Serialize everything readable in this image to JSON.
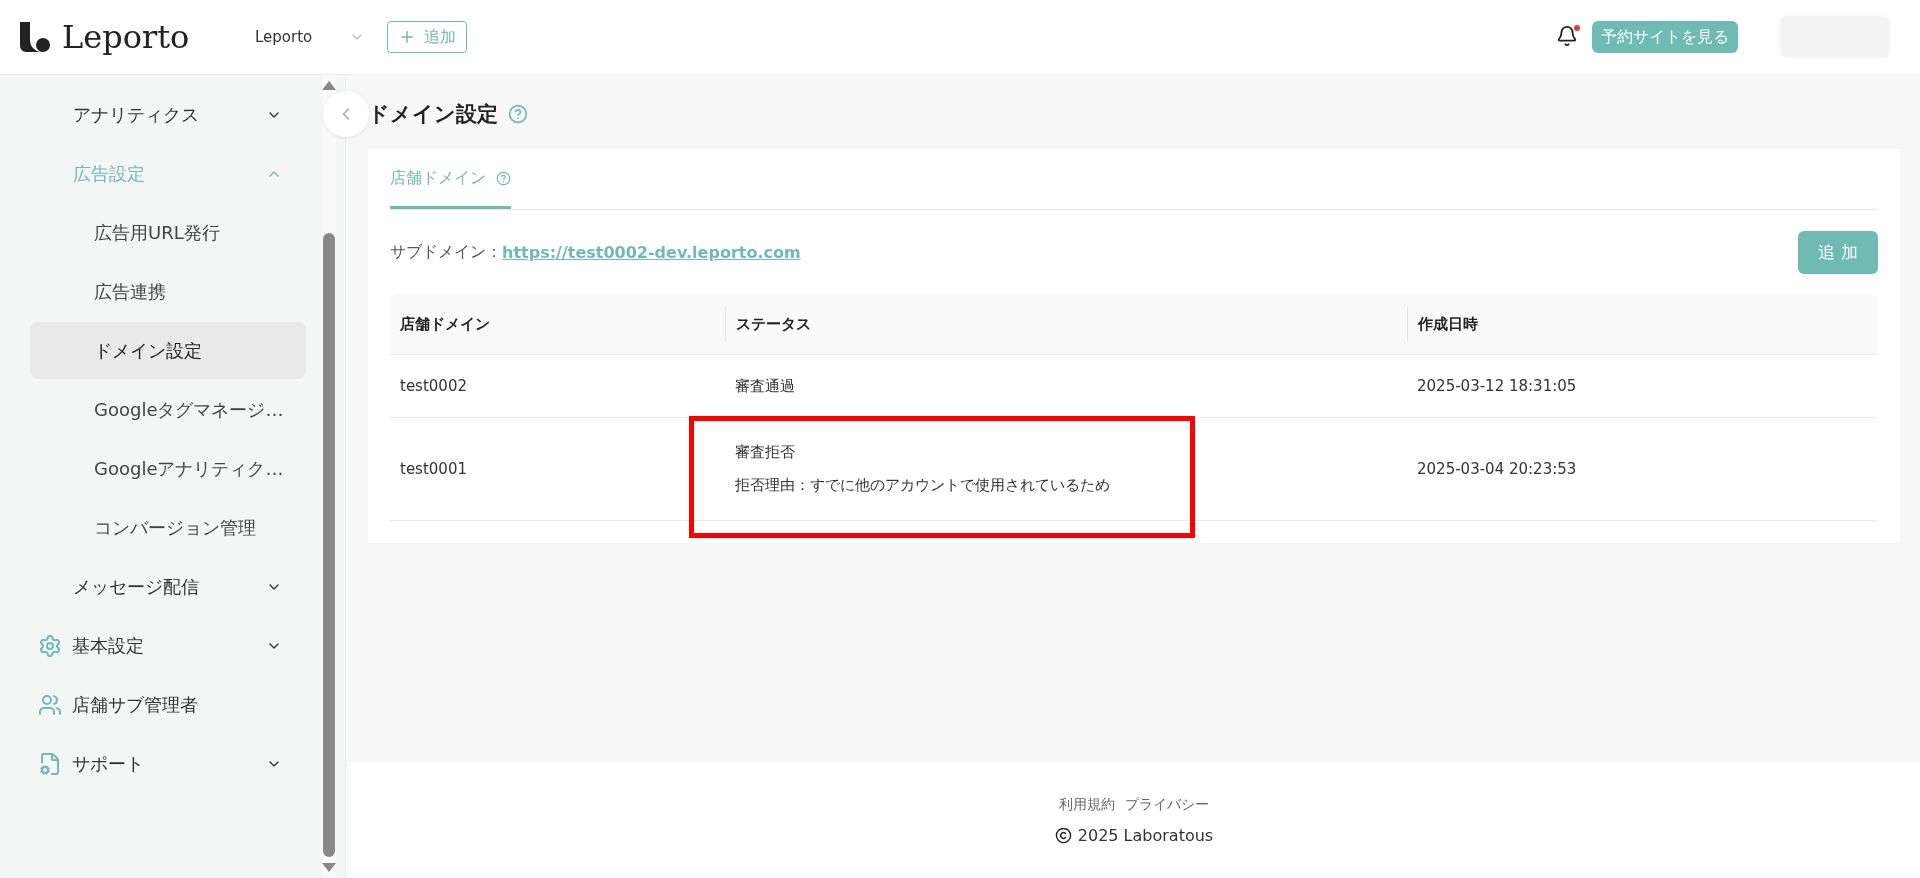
{
  "header": {
    "logo": "Leporto",
    "store_select": {
      "value": "Leporto"
    },
    "add_button": "追加",
    "notification": {
      "unread": true
    },
    "site_button": "予約サイトを見る"
  },
  "sidebar": {
    "sub_items": [
      {
        "label": "アナリティクス",
        "expanded": false
      },
      {
        "label": "広告設定",
        "expanded": true,
        "children": [
          {
            "label": "広告用URL発行",
            "selected": false
          },
          {
            "label": "広告連携",
            "selected": false
          },
          {
            "label": "ドメイン設定",
            "selected": true
          },
          {
            "label": "Googleタグマネージ…",
            "selected": false
          },
          {
            "label": "Googleアナリティク…",
            "selected": false
          },
          {
            "label": "コンバージョン管理",
            "selected": false
          }
        ]
      },
      {
        "label": "メッセージ配信",
        "expanded": false
      }
    ],
    "items": [
      {
        "label": "基本設定",
        "kind": "menu",
        "expanded": false
      },
      {
        "label": "店舗サブ管理者",
        "kind": "link"
      },
      {
        "label": "サポート",
        "kind": "menu",
        "expanded": false
      }
    ]
  },
  "page": {
    "title": "ドメイン設定",
    "tabs": [
      {
        "label": "店舗ドメイン",
        "selected": true
      }
    ],
    "subdomain": {
      "label": "サブドメイン：",
      "link": "https://test0002-dev.leporto.com"
    },
    "add_button": "追 加",
    "table": {
      "columns": [
        "店舗ドメイン",
        "ステータス",
        "作成日時"
      ],
      "rows": [
        {
          "domain": "test0002",
          "status": "審査通過",
          "created": "2025-03-12 18:31:05",
          "highlighted": false
        },
        {
          "domain": "test0001",
          "status": "審査拒否",
          "reason": "拒否理由：すでに他のアカウントで使用されているため",
          "created": "2025-03-04 20:23:53",
          "highlighted": true
        }
      ]
    }
  },
  "footer": {
    "links": [
      "利用規約",
      "プライバシー"
    ],
    "copyright": "2025 Laboratous"
  }
}
